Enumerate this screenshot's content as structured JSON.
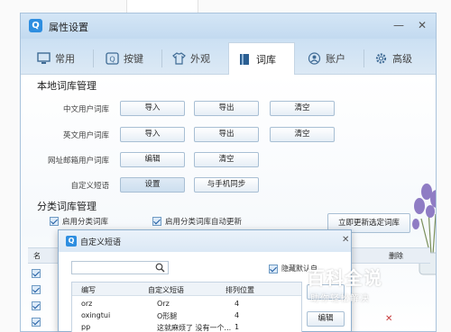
{
  "window": {
    "app_icon": "Q",
    "title": "属性设置",
    "minimize": "—",
    "close": "✕"
  },
  "tabs": [
    {
      "label": "常用",
      "icon": "monitor-icon"
    },
    {
      "label": "按键",
      "icon": "keyboard-key-icon"
    },
    {
      "label": "外观",
      "icon": "shirt-icon"
    },
    {
      "label": "词库",
      "icon": "book-icon",
      "active": true
    },
    {
      "label": "账户",
      "icon": "user-icon"
    },
    {
      "label": "高级",
      "icon": "gear-icon"
    }
  ],
  "local": {
    "title": "本地词库管理",
    "rows": [
      {
        "label": "中文用户词库",
        "buttons": [
          "导入",
          "导出",
          "清空"
        ]
      },
      {
        "label": "英文用户词库",
        "buttons": [
          "导入",
          "导出",
          "清空"
        ]
      },
      {
        "label": "网址邮箱用户词库",
        "buttons": [
          "编辑",
          "清空"
        ]
      },
      {
        "label": "自定义短语",
        "buttons": [
          "设置",
          "与手机同步"
        ]
      }
    ]
  },
  "category": {
    "title": "分类词库管理",
    "enable": "启用分类词库",
    "auto_update": "启用分类词库自动更新",
    "update_now": "立即更新选定词库",
    "col_name": "名",
    "col_delete": "删除"
  },
  "dialog": {
    "icon": "Q",
    "title": "自定义短语",
    "close": "✕",
    "hide_default": "隐藏默认自",
    "columns": [
      "编写",
      "自定义短语",
      "排列位置"
    ],
    "rows": [
      [
        "orz",
        "Orz",
        "4"
      ],
      [
        "oxingtui",
        "O形腿",
        "4"
      ],
      [
        "pp",
        "这就麻烦了 没有一个...",
        "1"
      ]
    ],
    "btn_edit": "编辑"
  },
  "watermark": {
    "title": "百科全说",
    "subtitle": "助你轻松解决"
  },
  "colors": {
    "accent": "#2e8ee0",
    "delete": "#c73a3a"
  }
}
